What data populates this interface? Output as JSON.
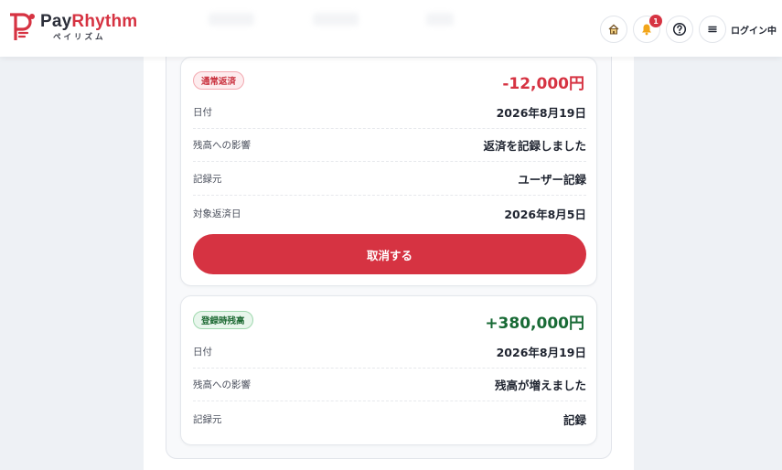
{
  "header": {
    "brand_name_left": "Pay",
    "brand_name_right": "Rhythm",
    "brand_kana": "ペイリズム",
    "notification_count": "1",
    "login_status": "ログイン中",
    "icons": [
      "home-icon",
      "bell-icon",
      "help-icon",
      "menu-icon"
    ]
  },
  "transactions": [
    {
      "tag": "通常返済",
      "amount": "-12,000円",
      "rows": [
        {
          "label": "日付",
          "value": "2026年8月19日"
        },
        {
          "label": "残高への影響",
          "value": "返済を記録しました"
        },
        {
          "label": "記録元",
          "value": "ユーザー記録"
        },
        {
          "label": "対象返済日",
          "value": "2026年8月5日"
        }
      ],
      "action_label": "取消する"
    },
    {
      "tag": "登録時残高",
      "amount": "+380,000円",
      "rows": [
        {
          "label": "日付",
          "value": "2026年8月19日"
        },
        {
          "label": "残高への影響",
          "value": "残高が増えました"
        },
        {
          "label": "記録元",
          "value": "記録"
        }
      ]
    }
  ],
  "colors": {
    "accent_red": "#d63342",
    "accent_green": "#186a35",
    "page_bg": "#eef1f5"
  }
}
